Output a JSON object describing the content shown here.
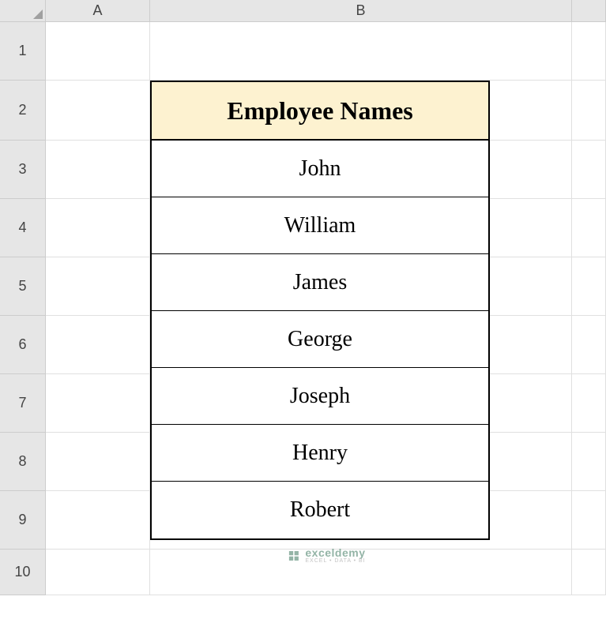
{
  "columns": {
    "a": "A",
    "b": "B"
  },
  "rows": {
    "r1": "1",
    "r2": "2",
    "r3": "3",
    "r4": "4",
    "r5": "5",
    "r6": "6",
    "r7": "7",
    "r8": "8",
    "r9": "9",
    "r10": "10"
  },
  "table": {
    "header": "Employee Names",
    "data": [
      "John",
      "William",
      "James",
      "George",
      "Joseph",
      "Henry",
      "Robert"
    ]
  },
  "watermark": {
    "brand": "exceldemy",
    "tagline": "EXCEL • DATA • BI"
  }
}
